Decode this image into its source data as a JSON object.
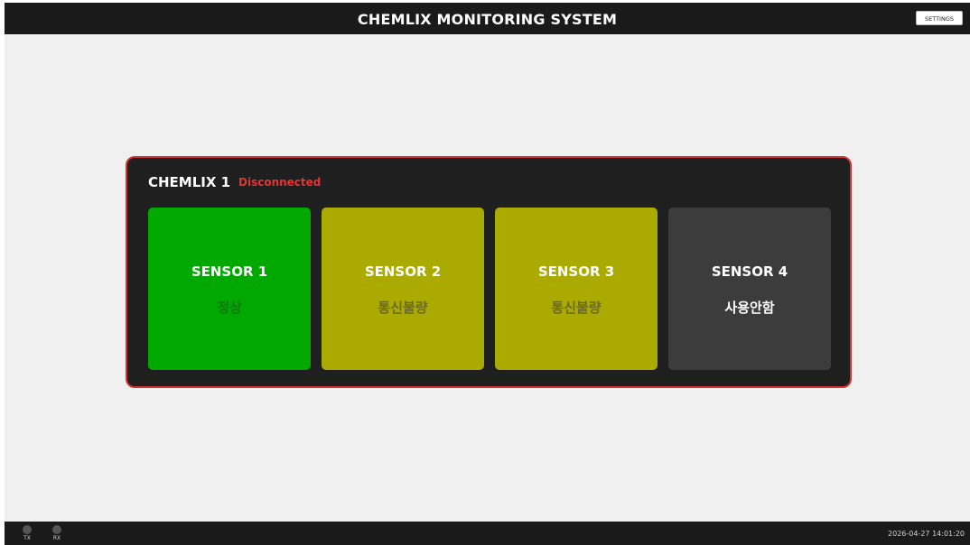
{
  "header": {
    "title": "CHEMLIX MONITORING SYSTEM",
    "settings_label": "SETTINGS"
  },
  "device": {
    "name": "CHEMLIX 1",
    "status": "Disconnected",
    "status_color": "#e03535",
    "border_color": "#d23232",
    "sensors": [
      {
        "name": "SENSOR 1",
        "state": "정상",
        "bg_color": "#00a800",
        "state_color": "#0a7a0a"
      },
      {
        "name": "SENSOR 2",
        "state": "통신불량",
        "bg_color": "#aaaa00",
        "state_color": "#6b6b1e"
      },
      {
        "name": "SENSOR 3",
        "state": "통신불량",
        "bg_color": "#aaaa00",
        "state_color": "#6b6b1e"
      },
      {
        "name": "SENSOR 4",
        "state": "사용안함",
        "bg_color": "#3c3c3c",
        "state_color": "#ffffff"
      }
    ]
  },
  "footer": {
    "tx_label": "TX",
    "rx_label": "RX",
    "datetime": "2026-04-27 14:01:20"
  }
}
